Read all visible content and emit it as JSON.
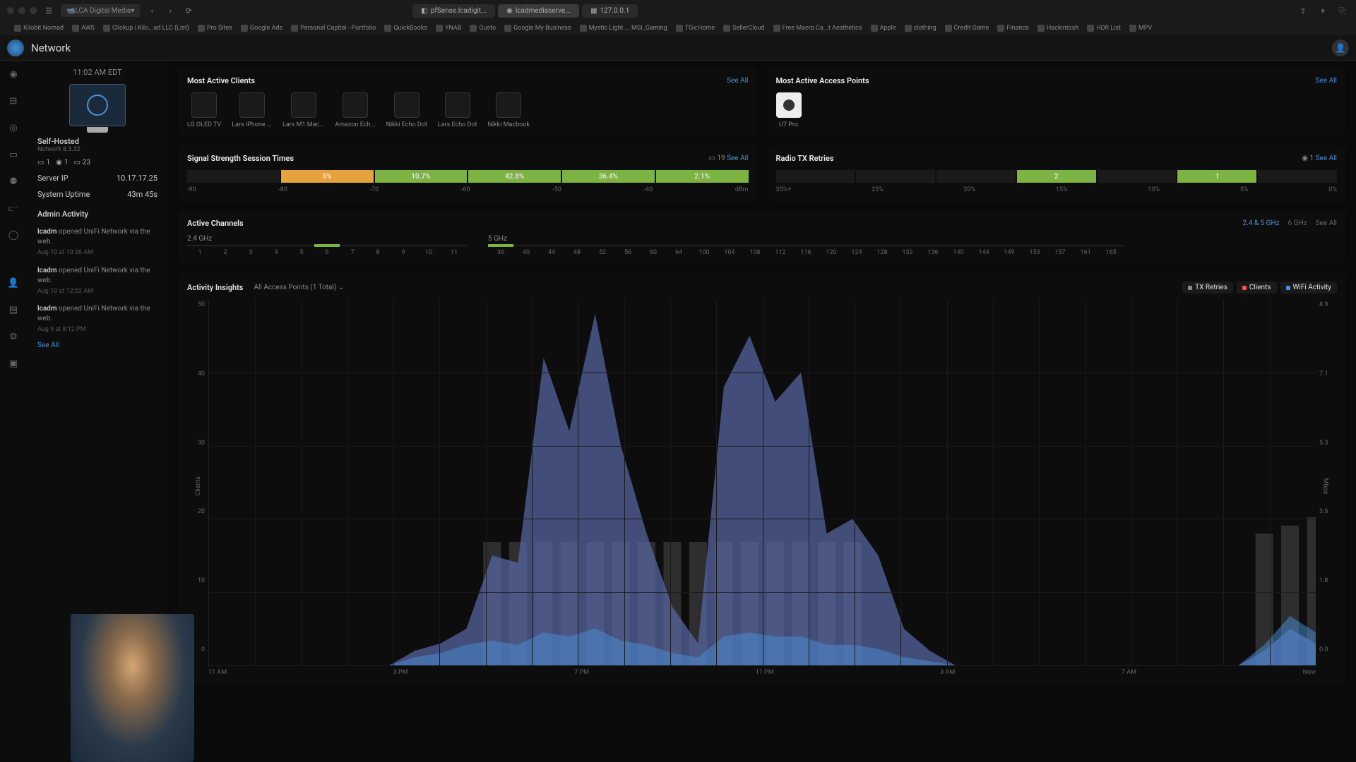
{
  "browser": {
    "profile": "LCA Digital Media",
    "tabs": [
      {
        "label": "pfSense.lcadigit..."
      },
      {
        "label": "lcadmediaserve..."
      },
      {
        "label": "127.0.0.1"
      }
    ],
    "bookmarks": [
      "Kilobit Nomad",
      "AWS",
      "Clickup | Kilo...ad LLC (List)",
      "Pro Sites",
      "Google Ads",
      "Personal Capital - Portfolio",
      "QuickBooks",
      "YNAB",
      "Gusto",
      "Google My Business",
      "Mystic Light ... MSI_Gaming",
      "TGx:Home",
      "SellerCloud",
      "Free Macro Ca...t Aesthetics",
      "Apple",
      "clothing",
      "Credit Game",
      "Finance",
      "Hackintosh",
      "HDR List",
      "MPV"
    ]
  },
  "app": {
    "title": "Network"
  },
  "sidebar": {
    "time": "11:02 AM EDT",
    "host_name": "Self-Hosted",
    "host_sub": "Network 8.3.32",
    "stats": {
      "a": "1",
      "b": "1",
      "c": "23"
    },
    "server_ip_label": "Server IP",
    "server_ip": "10.17.17.25",
    "uptime_label": "System Uptime",
    "uptime": "43m 45s",
    "admin_label": "Admin Activity",
    "activities": [
      {
        "user": "lcadm",
        "text": " opened UniFi Network via the web.",
        "time": "Aug 10 at 10:36 AM"
      },
      {
        "user": "lcadm",
        "text": " opened UniFi Network via the web.",
        "time": "Aug 10 at 12:02 AM"
      },
      {
        "user": "lcadm",
        "text": " opened UniFi Network via the web.",
        "time": "Aug 9 at 8:12 PM"
      }
    ],
    "see_all": "See All"
  },
  "panels": {
    "clients": {
      "title": "Most Active Clients",
      "see_all": "See All",
      "items": [
        "LG OLED TV",
        "Lars iPhone ...",
        "Lars M1 Mac...",
        "Amazon Ech...",
        "Nikki Echo Dot",
        "Lars Echo Dot",
        "Nikki Macbook"
      ]
    },
    "aps": {
      "title": "Most Active Access Points",
      "see_all": "See All",
      "items": [
        "U7 Pro"
      ]
    },
    "signal": {
      "title": "Signal Strength Session Times",
      "count": "19",
      "see_all": "See All",
      "labels": [
        "-90",
        "-80",
        "-70",
        "-60",
        "-50",
        "-40",
        "dBm"
      ]
    },
    "radio": {
      "title": "Radio TX Retries",
      "count": "1",
      "see_all": "See All",
      "labels": [
        "35%+",
        "25%",
        "20%",
        "15%",
        "10%",
        "5%",
        "0%"
      ]
    },
    "channels": {
      "title": "Active Channels",
      "b24": "2.4 GHz",
      "b5": "5 GHz",
      "nums24": [
        "1",
        "2",
        "3",
        "4",
        "5",
        "6",
        "7",
        "8",
        "9",
        "10",
        "11"
      ],
      "nums5": [
        "36",
        "40",
        "44",
        "48",
        "52",
        "56",
        "60",
        "64",
        "100",
        "104",
        "108",
        "112",
        "116",
        "120",
        "124",
        "128",
        "132",
        "136",
        "140",
        "144",
        "149",
        "153",
        "157",
        "161",
        "165"
      ],
      "filter_active": "2.4 & 5 GHz",
      "filter_6": "6 GHz",
      "see_all": "See All"
    },
    "insights": {
      "title": "Activity Insights",
      "filter": "All Access Points",
      "filter_count": "(1 Total)",
      "legend": [
        {
          "label": "TX Retries",
          "color": "#888"
        },
        {
          "label": "Clients",
          "color": "#ff5050"
        },
        {
          "label": "WiFi Activity",
          "color": "#4a90d9"
        }
      ],
      "y_left": [
        "50",
        "40",
        "30",
        "20",
        "10",
        "0"
      ],
      "y_right": [
        "8.9",
        "7.1",
        "5.3",
        "3.6",
        "1.8",
        "0.0"
      ],
      "y_left_label": "Clients",
      "y_right_label": "Mbps",
      "x": [
        "11 AM",
        "3 PM",
        "7 PM",
        "11 PM",
        "3 AM",
        "7 AM",
        "Now"
      ]
    }
  },
  "chart_data": {
    "type": "area",
    "title": "Activity Insights",
    "xlabel": "Time",
    "ylabel_left": "Clients",
    "ylabel_right": "Mbps",
    "ylim_left": [
      0,
      50
    ],
    "ylim_right": [
      0,
      8.9
    ],
    "x": [
      "11 AM",
      "3 PM",
      "7 PM",
      "11 PM",
      "3 AM",
      "7 AM",
      "Now"
    ],
    "series": [
      {
        "name": "Clients",
        "axis": "left",
        "color": "#5a6aa8",
        "values": [
          0,
          0,
          0,
          0,
          0,
          0,
          0,
          0,
          2,
          3,
          5,
          15,
          14,
          42,
          32,
          48,
          30,
          18,
          8,
          3,
          38,
          45,
          36,
          40,
          18,
          20,
          15,
          5,
          2,
          0,
          0,
          0,
          0,
          0,
          0,
          0,
          0,
          0,
          0,
          0,
          0,
          2,
          5,
          3
        ]
      },
      {
        "name": "WiFi Activity",
        "axis": "right",
        "color": "#4a90d9",
        "values": [
          0,
          0,
          0,
          0,
          0,
          0,
          0,
          0,
          0.2,
          0.3,
          0.5,
          0.6,
          0.5,
          0.8,
          0.7,
          0.9,
          0.6,
          0.5,
          0.3,
          0.2,
          0.7,
          0.8,
          0.7,
          0.7,
          0.5,
          0.5,
          0.4,
          0.2,
          0.1,
          0,
          0,
          0,
          0,
          0,
          0,
          0,
          0,
          0,
          0,
          0,
          0,
          0.5,
          1.2,
          0.8
        ]
      },
      {
        "name": "TX Retries",
        "axis": "right",
        "color": "#888",
        "values": [
          0,
          0,
          0,
          0,
          0,
          0,
          0,
          0,
          0,
          0,
          0,
          3.0,
          3.0,
          3.0,
          3.0,
          3.0,
          3.0,
          3.0,
          3.0,
          3.0,
          3.0,
          3.0,
          3.0,
          3.0,
          3.0,
          3.0,
          0,
          0,
          0,
          0,
          0,
          0,
          0,
          0,
          0,
          0,
          0,
          0,
          0,
          0,
          0,
          3.2,
          3.4,
          3.6
        ]
      }
    ],
    "signal_strength_bars": [
      {
        "range": "-90 to -80",
        "pct": 0,
        "color": "#1a1a1a"
      },
      {
        "range": "-80 to -70",
        "pct": 8,
        "color": "#e6a23c"
      },
      {
        "range": "-70 to -60",
        "pct": 10.7,
        "color": "#7cb342"
      },
      {
        "range": "-60 to -50",
        "pct": 42.8,
        "color": "#7cb342"
      },
      {
        "range": "-50 to -40",
        "pct": 36.4,
        "color": "#7cb342"
      },
      {
        "range": "-40+",
        "pct": 2.1,
        "color": "#7cb342"
      }
    ],
    "radio_tx_bars": [
      {
        "range": "35%+",
        "val": 0
      },
      {
        "range": "25%",
        "val": 0
      },
      {
        "range": "20%",
        "val": 0
      },
      {
        "range": "15%",
        "val": 2
      },
      {
        "range": "10%",
        "val": 0
      },
      {
        "range": "5%",
        "val": 1
      },
      {
        "range": "0%",
        "val": 0
      }
    ]
  }
}
